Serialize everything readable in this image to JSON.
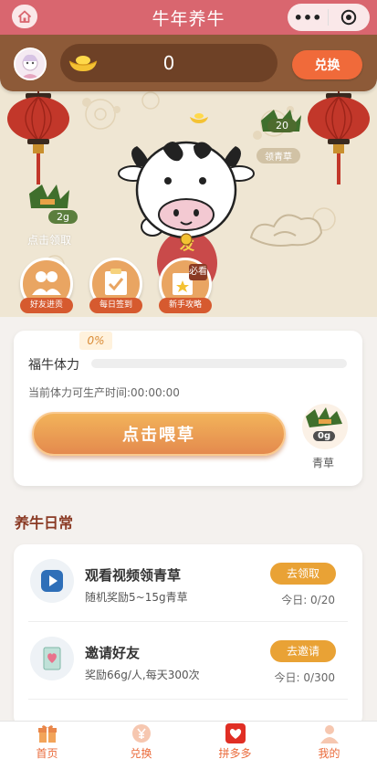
{
  "app": {
    "title": "牛年养牛"
  },
  "header": {
    "coin_balance": "0",
    "exchange_label": "兑换"
  },
  "scene": {
    "grass_bubble": "20",
    "pick_grass_label": "领青草",
    "stash_amount": "2g",
    "claim_label": "点击领取",
    "shirt_text": "发",
    "shortcuts": [
      {
        "label": "好友进贡",
        "icon": "friends-icon"
      },
      {
        "label": "每日签到",
        "icon": "checkin-icon"
      },
      {
        "label": "新手攻略",
        "icon": "guide-icon",
        "badge": "必看"
      }
    ]
  },
  "stamina": {
    "percent": "0%",
    "percent_value": 0,
    "label": "福牛体力",
    "timer_text": "当前体力可生产时间:00:00:00",
    "feed_label": "点击喂草",
    "grass_amount": "0g",
    "grass_label": "青草"
  },
  "daily": {
    "title": "养牛日常",
    "tasks": [
      {
        "title": "观看视频领青草",
        "desc": "随机奖励5~15g青草",
        "button": "去领取",
        "progress": "今日: 0/20",
        "icon": "video-play-icon"
      },
      {
        "title": "邀请好友",
        "desc": "奖励66g/人,每天300次",
        "button": "去邀请",
        "progress": "今日: 0/300",
        "icon": "invite-card-icon"
      }
    ]
  },
  "tabs": [
    {
      "label": "首页",
      "icon": "gift-box-icon"
    },
    {
      "label": "兑换",
      "icon": "yen-icon"
    },
    {
      "label": "拼多多",
      "icon": "pinduoduo-icon"
    },
    {
      "label": "我的",
      "icon": "profile-icon"
    }
  ],
  "colors": {
    "title_bar": "#d9666f",
    "header": "#8d5a38",
    "accent_orange": "#ea6a3a",
    "task_button": "#e9a235",
    "section_title": "#8a3a24"
  }
}
